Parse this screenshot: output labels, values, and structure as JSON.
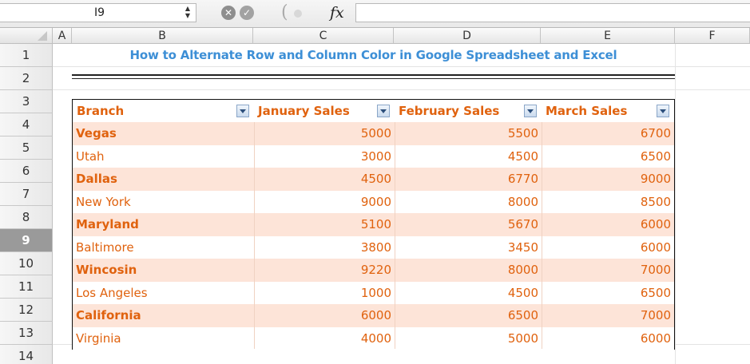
{
  "formula_bar": {
    "name_box": "I9",
    "fx_label": "fx",
    "formula": ""
  },
  "grid": {
    "columns": [
      "A",
      "B",
      "C",
      "D",
      "E",
      "F"
    ],
    "rows": [
      "1",
      "2",
      "3",
      "4",
      "5",
      "6",
      "7",
      "8",
      "9",
      "10",
      "11",
      "12",
      "13",
      "14"
    ],
    "selected_row": "9"
  },
  "sheet": {
    "title": "How to Alternate Row and Column Color in Google Spreadsheet and Excel",
    "headers": [
      "Branch",
      "January Sales",
      "February Sales",
      "March Sales"
    ],
    "rows": [
      [
        "Vegas",
        "5000",
        "5500",
        "6700"
      ],
      [
        "Utah",
        "3000",
        "4500",
        "6500"
      ],
      [
        "Dallas",
        "4500",
        "6770",
        "9000"
      ],
      [
        "New York",
        "9000",
        "8000",
        "8500"
      ],
      [
        "Maryland",
        "5100",
        "5670",
        "6000"
      ],
      [
        "Baltimore",
        "3800",
        "3450",
        "6000"
      ],
      [
        "Wincosin",
        "9220",
        "8000",
        "7000"
      ],
      [
        "Los Angeles",
        "1000",
        "4500",
        "6500"
      ],
      [
        "California",
        "6000",
        "6500",
        "7000"
      ],
      [
        "Virginia",
        "4000",
        "5000",
        "6000"
      ]
    ]
  },
  "colors": {
    "title": "#3d8fd6",
    "text_orange": "#e0620e",
    "band": "#fde4d8",
    "header_rule": "#e07b39"
  },
  "icons": {
    "name_box_stepper": "stepper-arrows-icon",
    "cancel": "cancel-circle-icon",
    "confirm": "check-circle-icon",
    "filter": "filter-dropdown-icon"
  }
}
